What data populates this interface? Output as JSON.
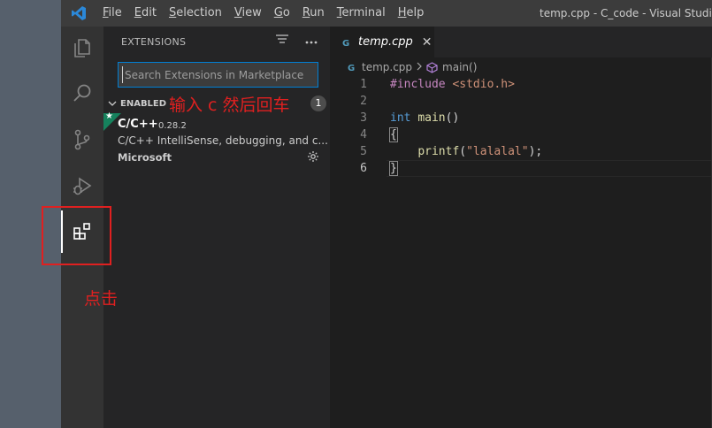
{
  "titlebar": {
    "menu": [
      {
        "accel": "F",
        "rest": "ile"
      },
      {
        "accel": "E",
        "rest": "dit"
      },
      {
        "accel": "S",
        "rest": "election"
      },
      {
        "accel": "V",
        "rest": "iew"
      },
      {
        "accel": "G",
        "rest": "o"
      },
      {
        "accel": "R",
        "rest": "un"
      },
      {
        "accel": "T",
        "rest": "erminal"
      },
      {
        "accel": "H",
        "rest": "elp"
      }
    ],
    "window_title": "temp.cpp - C_code - Visual Studio C"
  },
  "activity_bar": {
    "icons": [
      "explorer-icon",
      "search-icon",
      "source-control-icon",
      "run-debug-icon",
      "extensions-icon"
    ],
    "active": "extensions-icon"
  },
  "sidebar": {
    "header": "EXTENSIONS",
    "search_placeholder": "Search Extensions in Marketplace",
    "enabled_label": "ENABLED",
    "enabled_count": "1",
    "extension": {
      "name": "C/C++",
      "version": "0.28.2",
      "description": "C/C++ IntelliSense, debugging, and c...",
      "publisher": "Microsoft",
      "star": "★"
    }
  },
  "editor": {
    "tab_title": "temp.cpp",
    "tab_close": "✕",
    "breadcrumb": {
      "file": "temp.cpp",
      "symbol": "main()"
    },
    "line_numbers": [
      "1",
      "2",
      "3",
      "4",
      "5",
      "6"
    ],
    "code": {
      "l1_directive": "#include",
      "l1_header": "<stdio.h>",
      "l3_type": "int",
      "l3_fn": "main",
      "l3_parens": "()",
      "l4_brace": "{",
      "l5_indent": "    ",
      "l5_fn": "printf",
      "l5_open": "(",
      "l5_str": "\"lalalal\"",
      "l5_close": ");",
      "l6_brace": "}"
    }
  },
  "annotations": {
    "hint_type": "输入 c  然后回车",
    "hint_click": "点击",
    "color": "#e02020"
  }
}
